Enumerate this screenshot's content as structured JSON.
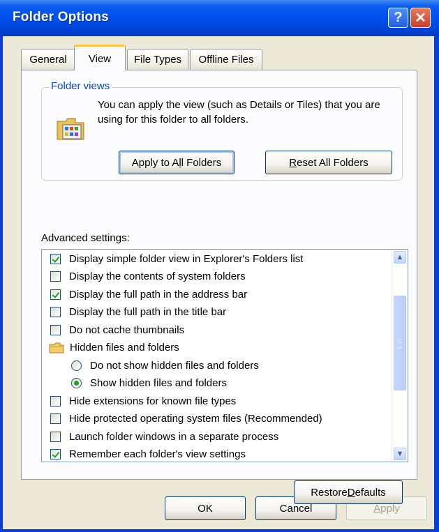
{
  "window": {
    "title": "Folder Options",
    "help_glyph": "?",
    "close_glyph": "✕"
  },
  "tabs": [
    {
      "label": "General",
      "active": false
    },
    {
      "label": "View",
      "active": true
    },
    {
      "label": "File Types",
      "active": false
    },
    {
      "label": "Offline Files",
      "active": false
    }
  ],
  "folder_views": {
    "caption": "Folder views",
    "description": "You can apply the view (such as Details or Tiles) that you are using for this folder to all folders.",
    "apply_button": {
      "pre": "Apply to A",
      "accel": "l",
      "post": "l Folders"
    },
    "reset_button": {
      "pre": "",
      "accel": "R",
      "post": "eset All Folders"
    }
  },
  "advanced": {
    "label": "Advanced settings:",
    "items": [
      {
        "type": "checkbox",
        "checked": true,
        "label": "Display simple folder view in Explorer's Folders list"
      },
      {
        "type": "checkbox",
        "checked": false,
        "label": "Display the contents of system folders"
      },
      {
        "type": "checkbox",
        "checked": true,
        "label": "Display the full path in the address bar"
      },
      {
        "type": "checkbox",
        "checked": false,
        "label": "Display the full path in the title bar"
      },
      {
        "type": "checkbox",
        "checked": false,
        "label": "Do not cache thumbnails"
      },
      {
        "type": "folder",
        "label": "Hidden files and folders"
      },
      {
        "type": "radio",
        "checked": false,
        "label": "Do not show hidden files and folders"
      },
      {
        "type": "radio",
        "checked": true,
        "label": "Show hidden files and folders"
      },
      {
        "type": "checkbox",
        "checked": false,
        "label": "Hide extensions for known file types"
      },
      {
        "type": "checkbox",
        "checked": false,
        "label": "Hide protected operating system files (Recommended)"
      },
      {
        "type": "checkbox",
        "checked": false,
        "label": "Launch folder windows in a separate process"
      },
      {
        "type": "checkbox",
        "checked": true,
        "label": "Remember each folder's view settings"
      }
    ]
  },
  "restore_button": {
    "pre": "Restore ",
    "accel": "D",
    "post": "efaults"
  },
  "footer": {
    "ok": "OK",
    "cancel": "Cancel",
    "apply": {
      "pre": "",
      "accel": "A",
      "post": "pply",
      "enabled": false
    }
  },
  "colors": {
    "titlebar": "#0050ee",
    "face": "#ece9d8",
    "group_caption": "#0046d5",
    "check": "#21a121",
    "tab_highlight": "#ffc83c"
  }
}
